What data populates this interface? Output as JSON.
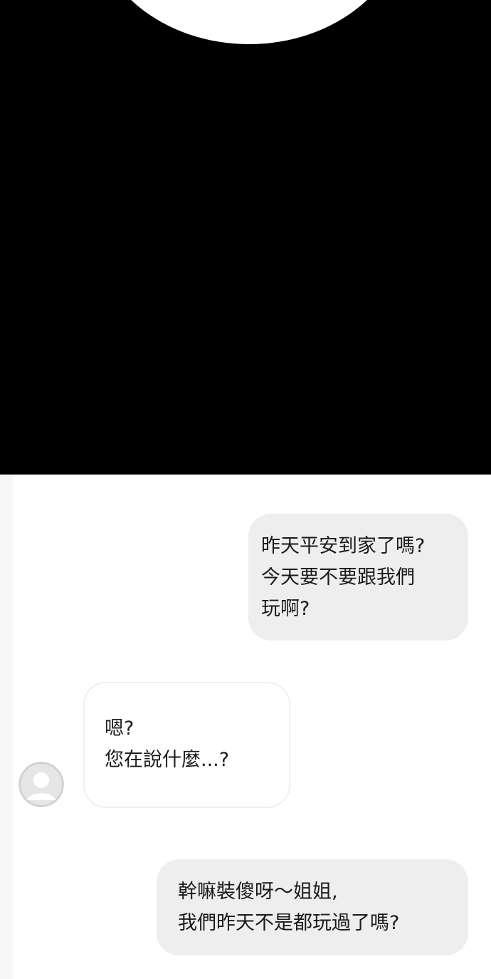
{
  "messages": [
    {
      "direction": "outgoing",
      "text": "昨天平安到家了嗎?\n今天要不要跟我們\n玩啊?"
    },
    {
      "direction": "incoming",
      "text": "嗯?\n您在說什麼...?"
    },
    {
      "direction": "outgoing",
      "text": "幹嘛裝傻呀〜姐姐,\n我們昨天不是都玩過了嗎?"
    }
  ],
  "avatar_icon": "default-user-icon",
  "colors": {
    "top_panel": "#000000",
    "outgoing_bubble": "#eeeeee",
    "incoming_bubble": "#ffffff",
    "avatar": "#dcdcdc"
  }
}
